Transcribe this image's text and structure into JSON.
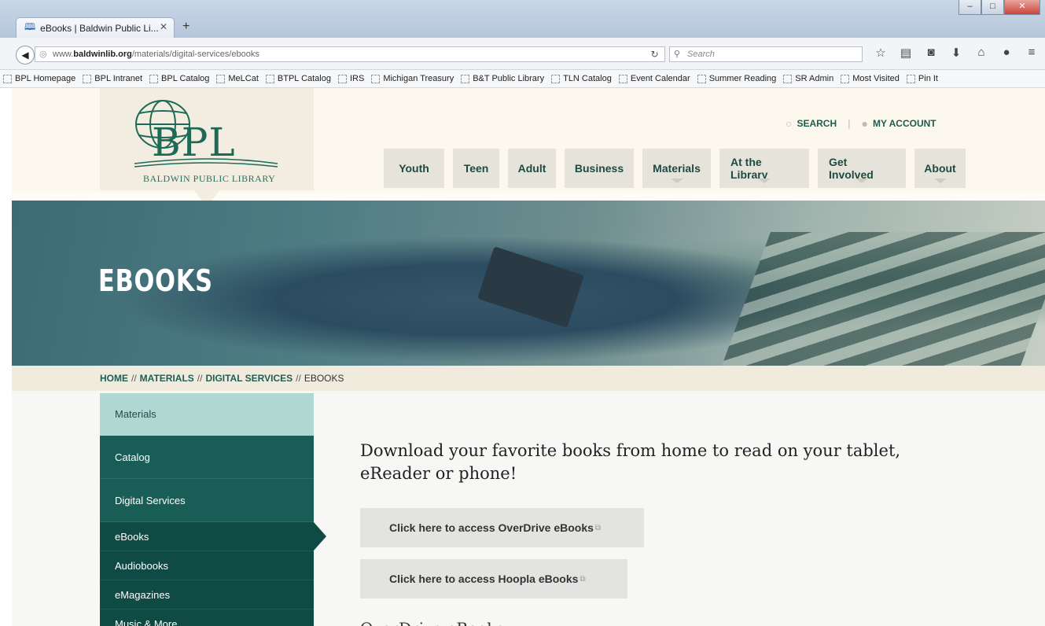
{
  "browser": {
    "tab_title": "eBooks | Baldwin Public Li...",
    "url_prefix": "www.",
    "url_domain": "baldwinlib.org",
    "url_path": "/materials/digital-services/ebooks",
    "search_placeholder": "Search",
    "bookmarks": [
      {
        "label": "BPL Homepage"
      },
      {
        "label": "BPL Intranet"
      },
      {
        "label": "BPL Catalog"
      },
      {
        "label": "MeLCat"
      },
      {
        "label": "BTPL Catalog"
      },
      {
        "label": "IRS"
      },
      {
        "label": "Michigan Treasury"
      },
      {
        "label": "B&T Public Library"
      },
      {
        "label": "TLN Catalog"
      },
      {
        "label": "Event Calendar"
      },
      {
        "label": "Summer Reading"
      },
      {
        "label": "SR Admin"
      },
      {
        "label": "Most Visited"
      },
      {
        "label": "Pin It"
      }
    ]
  },
  "header": {
    "logo_text": "BPL",
    "logo_sub": "BALDWIN PUBLIC LIBRARY",
    "search_label": "SEARCH",
    "account_label": "MY ACCOUNT",
    "nav": [
      {
        "label": "Youth",
        "dropdown": false
      },
      {
        "label": "Teen",
        "dropdown": false
      },
      {
        "label": "Adult",
        "dropdown": false
      },
      {
        "label": "Business",
        "dropdown": false
      },
      {
        "label": "Materials",
        "dropdown": true
      },
      {
        "label": "At the Library",
        "dropdown": true
      },
      {
        "label": "Get Involved",
        "dropdown": true
      },
      {
        "label": "About",
        "dropdown": true
      }
    ]
  },
  "hero": {
    "title": "EBOOKS"
  },
  "breadcrumb": {
    "home": "HOME",
    "materials": "MATERIALS",
    "digital": "DIGITAL SERVICES",
    "current": "EBOOKS",
    "separator": "//"
  },
  "sidebar": {
    "heading": "Materials",
    "items": [
      "Catalog",
      "Digital Services"
    ],
    "subitems": [
      "eBooks",
      "Audiobooks",
      "eMagazines",
      "Music & More"
    ]
  },
  "main": {
    "heading": "Download your favorite books from home to read on your tablet, eReader or phone!",
    "button1": "Click here to access OverDrive eBooks",
    "button2": "Click here to access Hoopla eBooks",
    "subheading": "OverDrive eBooks"
  }
}
